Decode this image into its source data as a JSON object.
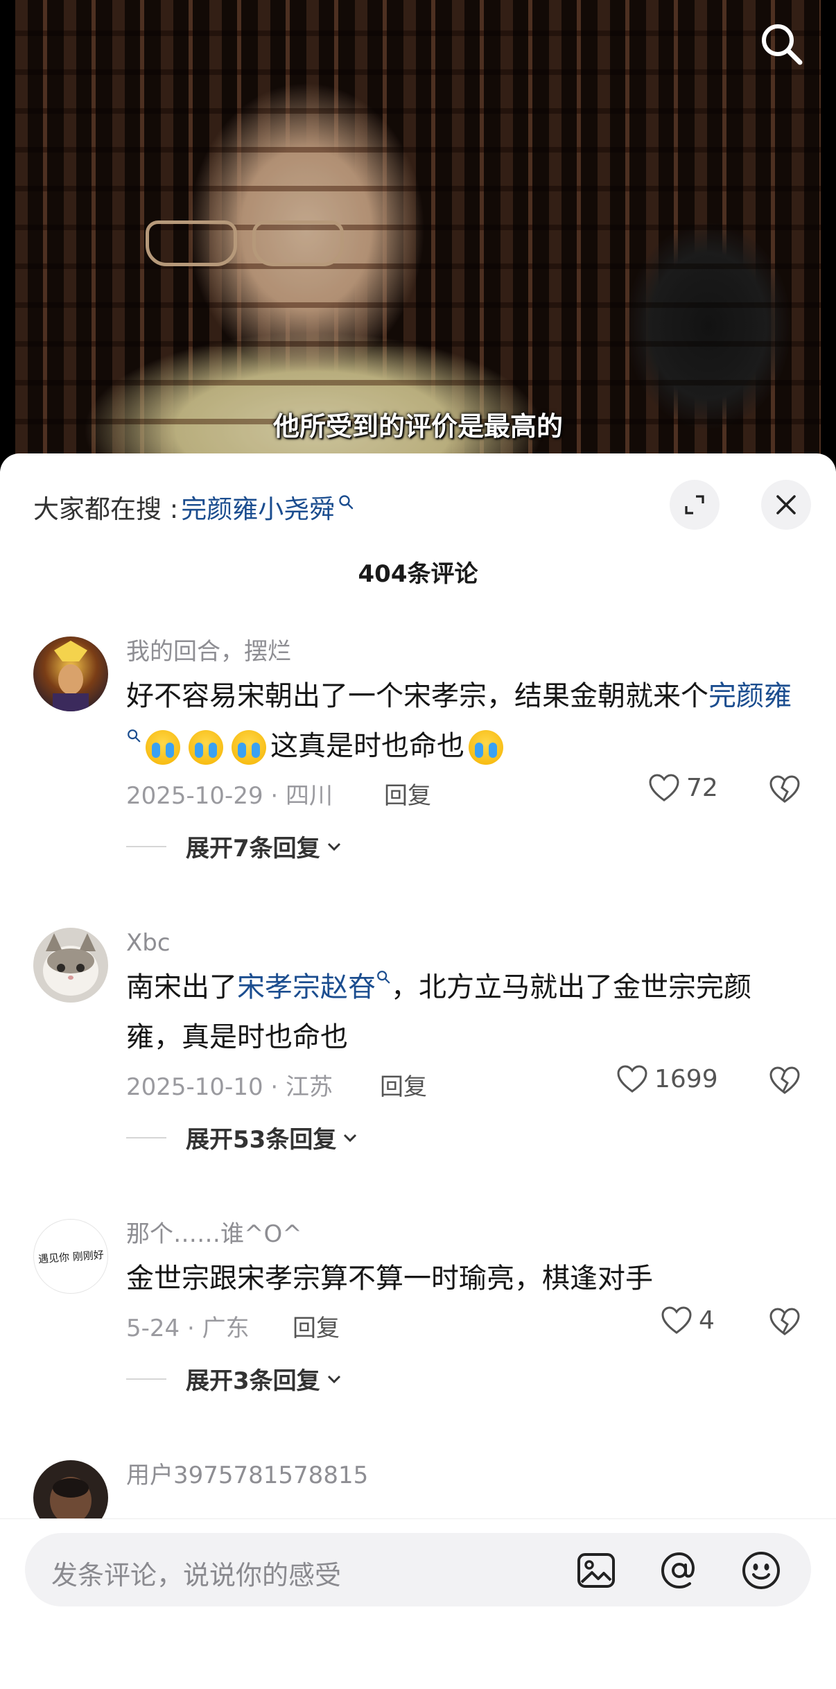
{
  "video": {
    "subtitle": "他所受到的评价是最高的",
    "search_icon": "search-icon"
  },
  "panel": {
    "hot_search_prefix": "大家都在搜 : ",
    "hot_search_term": "完颜雍小尧舜",
    "comment_count": "404条评论"
  },
  "comments": [
    {
      "user": "我的回合，摆烂",
      "text_before_link": "好不容易宋朝出了一个宋孝宗，结果金朝就来个",
      "link": "完颜雍",
      "text_after_link": "这真是时也命也",
      "date": "2025-10-29 · 四川",
      "reply_label": "回复",
      "likes": "72",
      "expand": "展开7条回复"
    },
    {
      "user": "Xbc",
      "text_before_link": "南宋出了",
      "link": "宋孝宗赵昚",
      "text_after_link": "，北方立马就出了金世宗完颜雍，真是时也命也",
      "date": "2025-10-10 · 江苏",
      "reply_label": "回复",
      "likes": "1699",
      "expand": "展开53条回复"
    },
    {
      "user": "那个……谁^O^",
      "avatar_text": "遇见你 刚刚好",
      "text": "金世宗跟宋孝宗算不算一时瑜亮，棋逢对手",
      "date": "5-24 · 广东",
      "reply_label": "回复",
      "likes": "4",
      "expand": "展开3条回复"
    },
    {
      "user": "用户3975781578815"
    }
  ],
  "input": {
    "placeholder": "发条评论，说说你的感受"
  },
  "icons": [
    "search-icon",
    "expand-icon",
    "close-icon",
    "heart-icon",
    "dislike-heart-icon",
    "chevron-down-icon",
    "image-icon",
    "at-icon",
    "emoji-icon"
  ]
}
